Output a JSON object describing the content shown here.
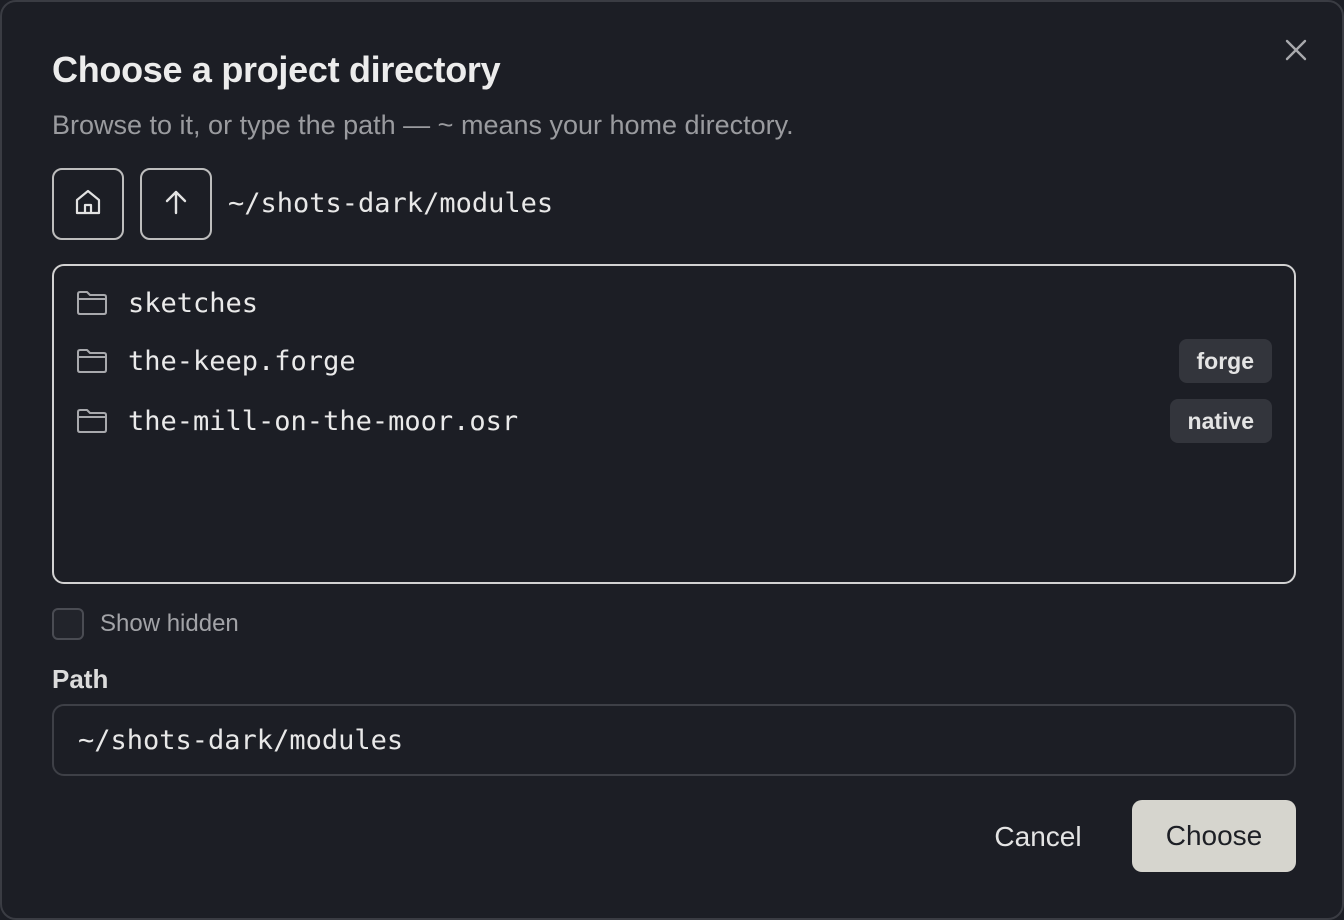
{
  "dialog": {
    "title": "Choose a project directory",
    "subtitle": "Browse to it, or type the path — ~ means your home directory.",
    "close_icon": "close-icon"
  },
  "navigation": {
    "home_icon": "home-icon",
    "up_icon": "arrow-up-icon",
    "current_path": "~/shots-dark/modules"
  },
  "entries": [
    {
      "name": "sketches",
      "badge": ""
    },
    {
      "name": "the-keep.forge",
      "badge": "forge"
    },
    {
      "name": "the-mill-on-the-moor.osr",
      "badge": "native"
    }
  ],
  "show_hidden": {
    "label": "Show hidden",
    "checked": false
  },
  "path_field": {
    "label": "Path",
    "value": "~/shots-dark/modules"
  },
  "actions": {
    "cancel_label": "Cancel",
    "choose_label": "Choose"
  },
  "colors": {
    "background": "#1c1e25",
    "badge_bg": "#33353c",
    "primary_button": "#d6d5ce"
  }
}
